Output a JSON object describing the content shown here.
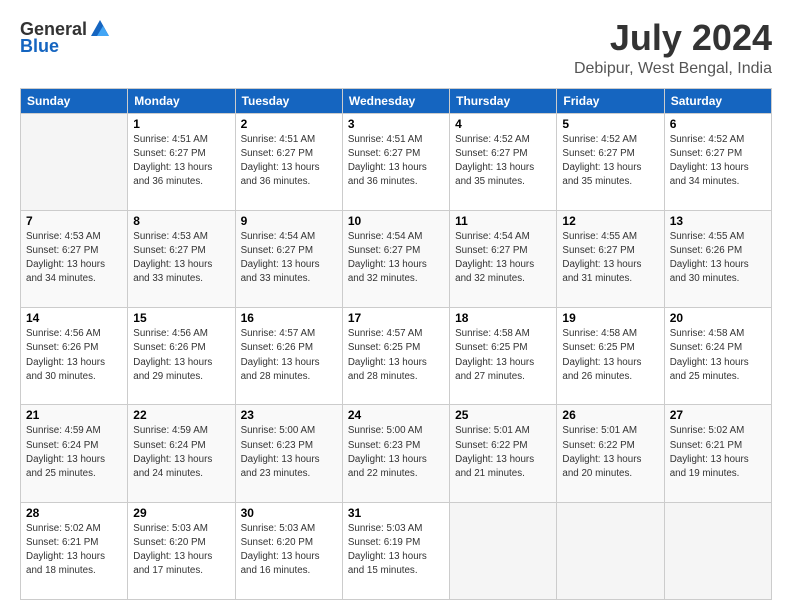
{
  "logo": {
    "general": "General",
    "blue": "Blue"
  },
  "title": "July 2024",
  "subtitle": "Debipur, West Bengal, India",
  "headers": [
    "Sunday",
    "Monday",
    "Tuesday",
    "Wednesday",
    "Thursday",
    "Friday",
    "Saturday"
  ],
  "weeks": [
    [
      {
        "day": "",
        "info": ""
      },
      {
        "day": "1",
        "info": "Sunrise: 4:51 AM\nSunset: 6:27 PM\nDaylight: 13 hours\nand 36 minutes."
      },
      {
        "day": "2",
        "info": "Sunrise: 4:51 AM\nSunset: 6:27 PM\nDaylight: 13 hours\nand 36 minutes."
      },
      {
        "day": "3",
        "info": "Sunrise: 4:51 AM\nSunset: 6:27 PM\nDaylight: 13 hours\nand 36 minutes."
      },
      {
        "day": "4",
        "info": "Sunrise: 4:52 AM\nSunset: 6:27 PM\nDaylight: 13 hours\nand 35 minutes."
      },
      {
        "day": "5",
        "info": "Sunrise: 4:52 AM\nSunset: 6:27 PM\nDaylight: 13 hours\nand 35 minutes."
      },
      {
        "day": "6",
        "info": "Sunrise: 4:52 AM\nSunset: 6:27 PM\nDaylight: 13 hours\nand 34 minutes."
      }
    ],
    [
      {
        "day": "7",
        "info": "Sunrise: 4:53 AM\nSunset: 6:27 PM\nDaylight: 13 hours\nand 34 minutes."
      },
      {
        "day": "8",
        "info": "Sunrise: 4:53 AM\nSunset: 6:27 PM\nDaylight: 13 hours\nand 33 minutes."
      },
      {
        "day": "9",
        "info": "Sunrise: 4:54 AM\nSunset: 6:27 PM\nDaylight: 13 hours\nand 33 minutes."
      },
      {
        "day": "10",
        "info": "Sunrise: 4:54 AM\nSunset: 6:27 PM\nDaylight: 13 hours\nand 32 minutes."
      },
      {
        "day": "11",
        "info": "Sunrise: 4:54 AM\nSunset: 6:27 PM\nDaylight: 13 hours\nand 32 minutes."
      },
      {
        "day": "12",
        "info": "Sunrise: 4:55 AM\nSunset: 6:27 PM\nDaylight: 13 hours\nand 31 minutes."
      },
      {
        "day": "13",
        "info": "Sunrise: 4:55 AM\nSunset: 6:26 PM\nDaylight: 13 hours\nand 30 minutes."
      }
    ],
    [
      {
        "day": "14",
        "info": "Sunrise: 4:56 AM\nSunset: 6:26 PM\nDaylight: 13 hours\nand 30 minutes."
      },
      {
        "day": "15",
        "info": "Sunrise: 4:56 AM\nSunset: 6:26 PM\nDaylight: 13 hours\nand 29 minutes."
      },
      {
        "day": "16",
        "info": "Sunrise: 4:57 AM\nSunset: 6:26 PM\nDaylight: 13 hours\nand 28 minutes."
      },
      {
        "day": "17",
        "info": "Sunrise: 4:57 AM\nSunset: 6:25 PM\nDaylight: 13 hours\nand 28 minutes."
      },
      {
        "day": "18",
        "info": "Sunrise: 4:58 AM\nSunset: 6:25 PM\nDaylight: 13 hours\nand 27 minutes."
      },
      {
        "day": "19",
        "info": "Sunrise: 4:58 AM\nSunset: 6:25 PM\nDaylight: 13 hours\nand 26 minutes."
      },
      {
        "day": "20",
        "info": "Sunrise: 4:58 AM\nSunset: 6:24 PM\nDaylight: 13 hours\nand 25 minutes."
      }
    ],
    [
      {
        "day": "21",
        "info": "Sunrise: 4:59 AM\nSunset: 6:24 PM\nDaylight: 13 hours\nand 25 minutes."
      },
      {
        "day": "22",
        "info": "Sunrise: 4:59 AM\nSunset: 6:24 PM\nDaylight: 13 hours\nand 24 minutes."
      },
      {
        "day": "23",
        "info": "Sunrise: 5:00 AM\nSunset: 6:23 PM\nDaylight: 13 hours\nand 23 minutes."
      },
      {
        "day": "24",
        "info": "Sunrise: 5:00 AM\nSunset: 6:23 PM\nDaylight: 13 hours\nand 22 minutes."
      },
      {
        "day": "25",
        "info": "Sunrise: 5:01 AM\nSunset: 6:22 PM\nDaylight: 13 hours\nand 21 minutes."
      },
      {
        "day": "26",
        "info": "Sunrise: 5:01 AM\nSunset: 6:22 PM\nDaylight: 13 hours\nand 20 minutes."
      },
      {
        "day": "27",
        "info": "Sunrise: 5:02 AM\nSunset: 6:21 PM\nDaylight: 13 hours\nand 19 minutes."
      }
    ],
    [
      {
        "day": "28",
        "info": "Sunrise: 5:02 AM\nSunset: 6:21 PM\nDaylight: 13 hours\nand 18 minutes."
      },
      {
        "day": "29",
        "info": "Sunrise: 5:03 AM\nSunset: 6:20 PM\nDaylight: 13 hours\nand 17 minutes."
      },
      {
        "day": "30",
        "info": "Sunrise: 5:03 AM\nSunset: 6:20 PM\nDaylight: 13 hours\nand 16 minutes."
      },
      {
        "day": "31",
        "info": "Sunrise: 5:03 AM\nSunset: 6:19 PM\nDaylight: 13 hours\nand 15 minutes."
      },
      {
        "day": "",
        "info": ""
      },
      {
        "day": "",
        "info": ""
      },
      {
        "day": "",
        "info": ""
      }
    ]
  ]
}
